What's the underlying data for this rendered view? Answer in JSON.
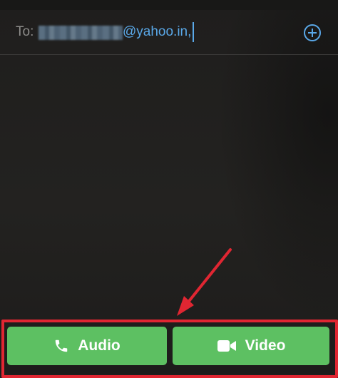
{
  "compose": {
    "to_label": "To:",
    "recipient_visible": "@yahoo.in,"
  },
  "actions": {
    "audio_label": "Audio",
    "video_label": "Video"
  },
  "icons": {
    "add": "plus-circle-icon",
    "audio": "phone-icon",
    "video": "video-camera-icon"
  },
  "colors": {
    "accent_blue": "#5aa8e8",
    "call_green": "#5dc062",
    "highlight_red": "#e02632",
    "background": "#1f1e1d"
  }
}
